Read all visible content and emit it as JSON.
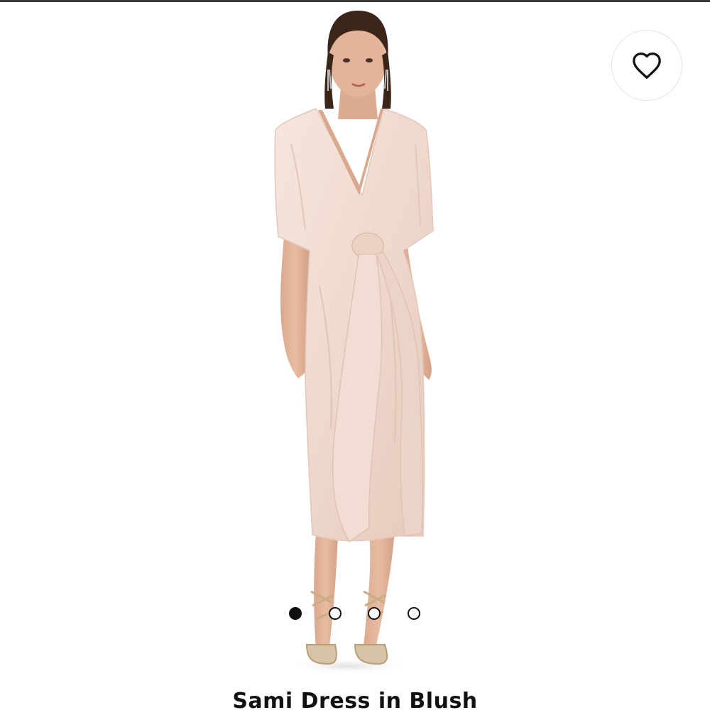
{
  "product": {
    "title": "Sami Dress in Blush",
    "image_alt": "Model wearing blush wrap midi dress with tie waist and gold strappy heels"
  },
  "favorite": {
    "icon": "heart-icon",
    "selected": false
  },
  "gallery": {
    "image_count": 4,
    "active_index": 0
  },
  "colors": {
    "background": "#ffffff",
    "dress": "#f2dcd3",
    "text": "#111111"
  }
}
